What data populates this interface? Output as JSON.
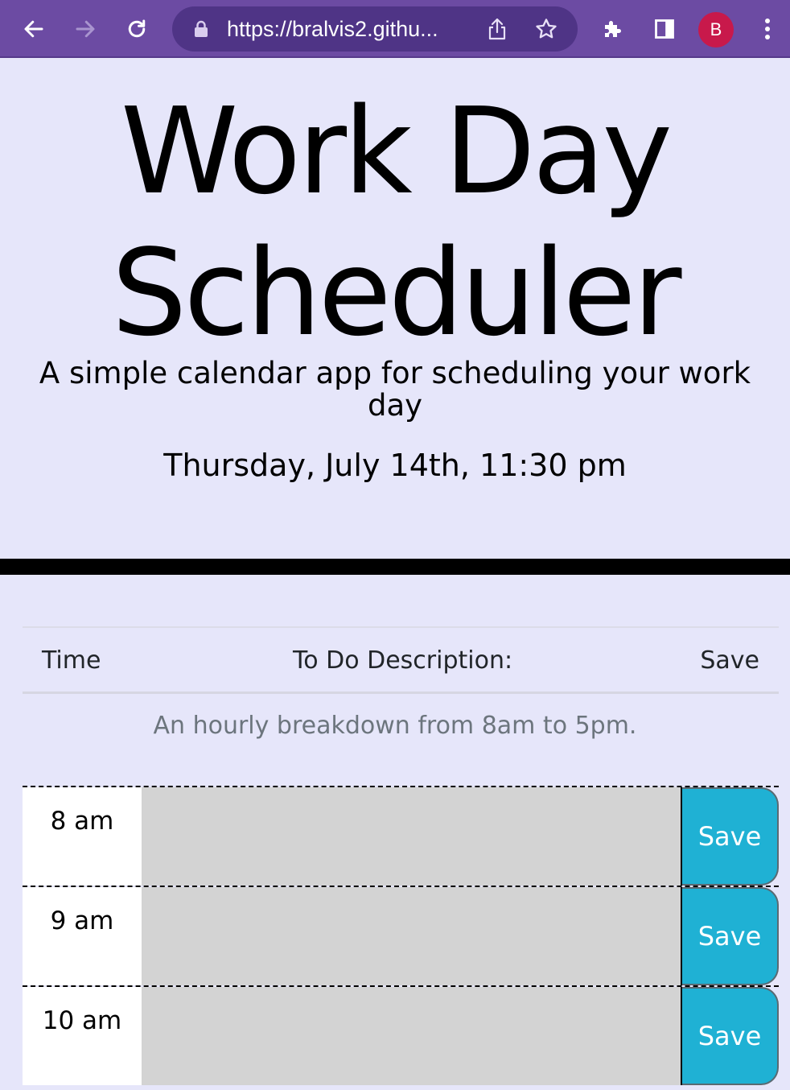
{
  "browser": {
    "url": "https://bralvis2.githu...",
    "profile_initial": "B",
    "toolbar_color": "#6c4ba3",
    "icons": [
      "back-arrow-icon",
      "forward-arrow-icon",
      "reload-icon",
      "lock-icon",
      "share-icon",
      "star-icon",
      "extensions-icon",
      "side-panel-icon",
      "kebab-menu-icon"
    ]
  },
  "header": {
    "title": "Work Day Scheduler",
    "lead": "A simple calendar app for scheduling your work day",
    "current_day": "Thursday, July 14th, 11:30 pm"
  },
  "table": {
    "col_time": "Time",
    "col_description": "To Do Description:",
    "col_save": "Save",
    "caption": "An hourly breakdown from 8am to 5pm."
  },
  "time_blocks": [
    {
      "hour": "8 am",
      "description": "",
      "save_label": "Save"
    },
    {
      "hour": "9 am",
      "description": "",
      "save_label": "Save"
    },
    {
      "hour": "10 am",
      "description": "",
      "save_label": "Save"
    }
  ],
  "colors": {
    "page_background": "#e6e6fa",
    "past_block": "#d3d3d3",
    "save_button": "#1fb1d4"
  }
}
